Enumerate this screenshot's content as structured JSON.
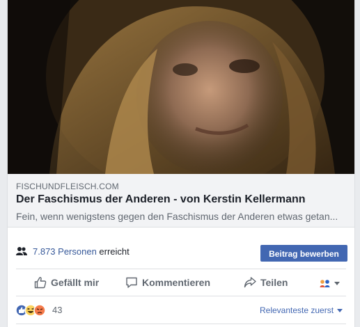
{
  "link_preview": {
    "domain": "FISCHUNDFLEISCH.COM",
    "title": "Der Faschismus der Anderen - von Kerstin Kellermann",
    "description": "Fein, wenn wenigstens gegen den Faschismus der Anderen etwas getan..."
  },
  "reach": {
    "count": "7.873 Personen",
    "suffix": "erreicht",
    "boost_label": "Beitrag bewerben"
  },
  "actions": {
    "like_label": "Gefällt mir",
    "comment_label": "Kommentieren",
    "share_label": "Teilen",
    "audience_icon": "audience-selector-icon"
  },
  "reactions": {
    "icons": [
      "like-reaction-icon",
      "haha-reaction-icon",
      "angry-reaction-icon"
    ],
    "count": "43",
    "sort_label": "Relevanteste zuerst"
  },
  "colors": {
    "link_blue": "#365899",
    "button_blue": "#4267b2",
    "secondary_text": "#606770"
  }
}
